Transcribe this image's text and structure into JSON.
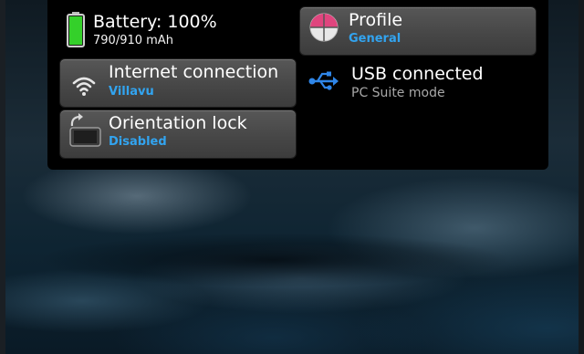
{
  "battery": {
    "title": "Battery: 100%",
    "detail": "790/910 mAh",
    "level": 1.0,
    "color": "#34d02a"
  },
  "profile": {
    "title": "Profile",
    "value": "General"
  },
  "internet": {
    "title": "Internet connection",
    "value": "Villavu"
  },
  "usb": {
    "title": "USB connected",
    "value": "PC Suite mode"
  },
  "orientation": {
    "title": "Orientation lock",
    "value": "Disabled"
  },
  "colors": {
    "accent": "#32a4f0",
    "panel": "#000000",
    "tile": "#4a4a4a",
    "profile_pink": "#e0457e"
  },
  "icons": [
    "battery-icon",
    "profile-icon",
    "wifi-icon",
    "usb-icon",
    "orientation-lock-icon"
  ]
}
